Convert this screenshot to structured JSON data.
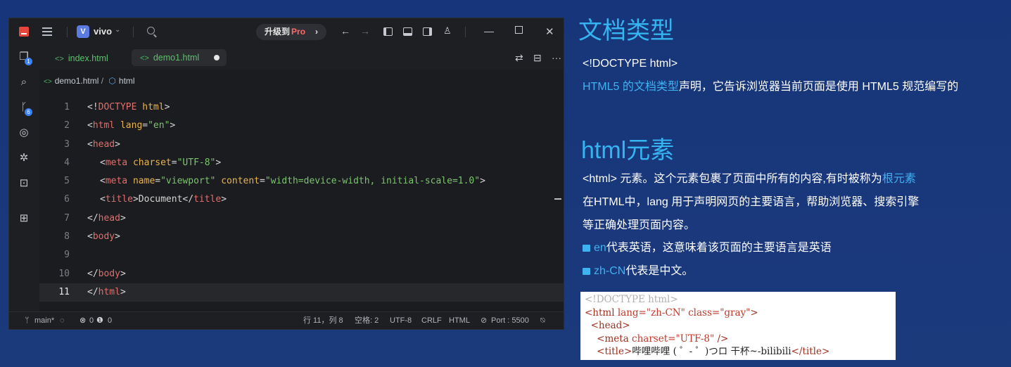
{
  "titlebar": {
    "project_badge": "V",
    "project_name": "vivo",
    "upgrade_prefix": "升级到",
    "upgrade_pro": "Pro"
  },
  "activity_badges": {
    "explorer": "1",
    "scm": "6"
  },
  "tabs": [
    {
      "label": "index.html"
    },
    {
      "label": "demo1.html"
    }
  ],
  "breadcrumb": {
    "file": "demo1.html",
    "sep": "/",
    "node": "html"
  },
  "code_lines": [
    {
      "n": "1"
    },
    {
      "n": "2"
    },
    {
      "n": "3"
    },
    {
      "n": "4"
    },
    {
      "n": "5"
    },
    {
      "n": "6"
    },
    {
      "n": "7"
    },
    {
      "n": "8"
    },
    {
      "n": "9"
    },
    {
      "n": "10"
    },
    {
      "n": "11"
    }
  ],
  "code": {
    "l1_open": "<!",
    "l1_tag": "DOCTYPE",
    "l1_attr": " html",
    "l1_close": ">",
    "l2_open": "<",
    "l2_tag": "html",
    "l2_attr": " lang",
    "l2_eq": "=",
    "l2_val": "\"en\"",
    "l2_close": ">",
    "l3_open": "<",
    "l3_tag": "head",
    "l3_close": ">",
    "l4_open": "<",
    "l4_tag": "meta",
    "l4_attr": " charset",
    "l4_eq": "=",
    "l4_val": "\"UTF-8\"",
    "l4_close": ">",
    "l5_open": "<",
    "l5_tag": "meta",
    "l5_attr1": " name",
    "l5_eq1": "=",
    "l5_val1": "\"viewport\"",
    "l5_attr2": " content",
    "l5_eq2": "=",
    "l5_val2": "\"width=device-width, initial-scale=1.0\"",
    "l5_close": ">",
    "l6_open": "<",
    "l6_tag": "title",
    "l6_mid": ">",
    "l6_text": "Document",
    "l6_open2": "</",
    "l6_tag2": "title",
    "l6_close": ">",
    "l7_open": "</",
    "l7_tag": "head",
    "l7_close": ">",
    "l8_open": "<",
    "l8_tag": "body",
    "l8_close": ">",
    "l10_open": "</",
    "l10_tag": "body",
    "l10_close": ">",
    "l11_open": "</",
    "l11_tag": "html",
    "l11_close": ">"
  },
  "status": {
    "branch": "main*",
    "errors": "0",
    "warnings": "0",
    "position": "行 11，列 8",
    "spaces": "空格: 2",
    "encoding": "UTF-8",
    "eol": "CRLF",
    "language": "HTML",
    "port": "Port : 5500"
  },
  "panel": {
    "doctype_heading": "文档类型",
    "doctype_code": "<!DOCTYPE html>",
    "doctype_desc_hl": "HTML5 的文档类型",
    "doctype_desc_rest": "声明，它告诉浏览器当前页面是使用 HTML5 规范编写的",
    "html_heading": "html元素",
    "html_line1_pre": "<html> 元素。这个元素包裹了页面中所有的内容,有时被称为",
    "html_line1_hl": "根元素",
    "html_line2": "在HTML中，lang 用于声明网页的主要语言，帮助浏览器、搜索引擎",
    "html_line3": "等正确处理页面内容。",
    "bullet1_hl": "en",
    "bullet1_rest": "代表英语，这意味着该页面的主要语言是英语",
    "bullet2_hl": "zh-CN",
    "bullet2_rest": "代表是中文。"
  },
  "snippet": {
    "line1": "<!DOCTYPE html>",
    "line2_a": "<html ",
    "line2_b": "lang=",
    "line2_c": "\"zh-CN\"",
    "line2_d": " class=",
    "line2_e": "\"gray\"",
    "line2_f": ">",
    "line3": "<head>",
    "line4_a": "<meta ",
    "line4_b": "charset=",
    "line4_c": "\"UTF-8\"",
    "line4_d": " />",
    "line5_a": "<title>",
    "line5_b": "哔哩哔哩 ( ゜- ゜)つロ 干杯~-bilibili",
    "line5_c": "</title>"
  }
}
